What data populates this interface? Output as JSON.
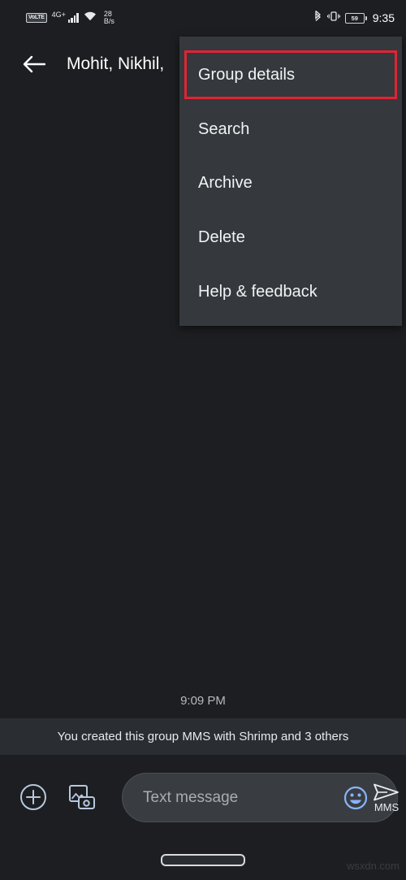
{
  "status_bar": {
    "volte_badge": "VoLTE",
    "network_type": "4G+",
    "signal_icon": "signal-bars-icon",
    "wifi_icon": "wifi-icon",
    "data_speed_value": "28",
    "data_speed_unit": "B/s",
    "bluetooth_icon": "bluetooth-icon",
    "vibrate_icon": "vibrate-icon",
    "battery_percent": "59",
    "time": "9:35"
  },
  "app_bar": {
    "back_icon": "back-arrow-icon",
    "title": "Mohit, Nikhil,"
  },
  "overflow_menu": {
    "items": [
      {
        "label": "Group details",
        "highlighted": true
      },
      {
        "label": "Search",
        "highlighted": false
      },
      {
        "label": "Archive",
        "highlighted": false
      },
      {
        "label": "Delete",
        "highlighted": false
      },
      {
        "label": "Help & feedback",
        "highlighted": false
      }
    ],
    "highlight_color": "#e02434"
  },
  "conversation": {
    "timestamp": "9:09 PM",
    "system_message": "You created this group MMS with Shrimp  and 3 others"
  },
  "composer": {
    "add_icon": "plus-circle-icon",
    "gallery_icon": "gallery-camera-icon",
    "input_placeholder": "Text message",
    "input_value": "",
    "emoji_icon": "emoji-smiley-icon",
    "send_icon": "send-arrow-icon",
    "send_label": "MMS"
  },
  "nav_bar": {
    "gesture_pill": "home-gesture-pill"
  },
  "watermark": "wsxdn.com"
}
